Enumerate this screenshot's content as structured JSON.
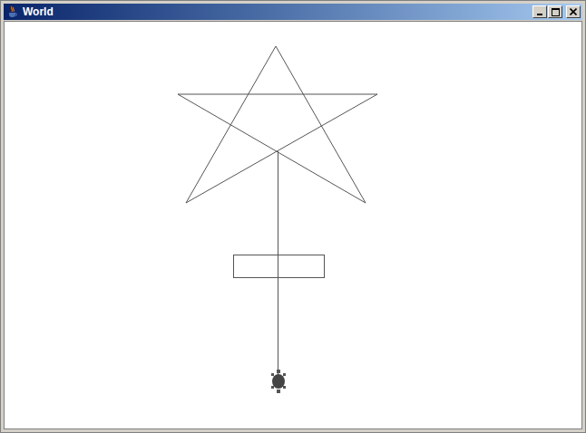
{
  "window": {
    "title": "World"
  }
}
